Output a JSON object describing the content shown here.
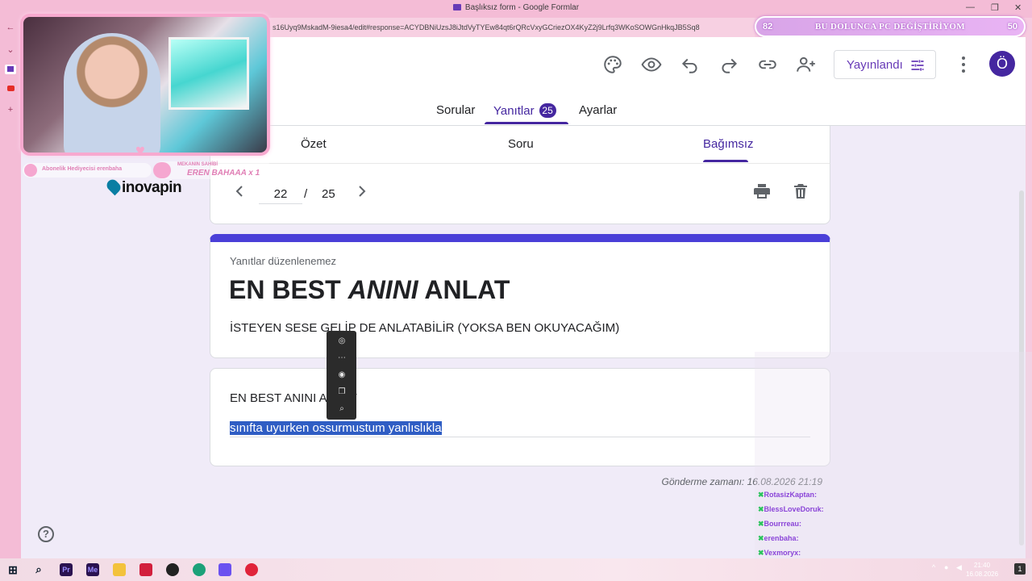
{
  "window": {
    "title": "Başlıksız form - Google Formlar"
  },
  "address": {
    "url": "s16Uyq9MskadM-9iesa4/edit#response=ACYDBNiUzsJ8iJtdVyTYEw84qt6rQRcVxyGCriezOX4KyZ2j9Lrfq3WKoSOWGnHkqJB5Sq8"
  },
  "goal": {
    "left": "82",
    "text": "BU DOLUNCA PC DEĞİŞTİRİYOM",
    "right": "50"
  },
  "header": {
    "publish_label": "Yayınlandı",
    "avatar_letter": "Ö"
  },
  "tabs": [
    {
      "label": "Sorular"
    },
    {
      "label": "Yanıtlar",
      "badge": "25"
    },
    {
      "label": "Ayarlar"
    }
  ],
  "subtabs": [
    {
      "label": "Özet"
    },
    {
      "label": "Soru"
    },
    {
      "label": "Bağımsız"
    }
  ],
  "nav": {
    "current": "22",
    "separator": "/",
    "total": "25"
  },
  "form": {
    "note": "Yanıtlar düzenlenemez",
    "title_part1": "EN BEST ",
    "title_part2": "ANINI",
    "title_part3": " ANLAT",
    "description": "İSTEYEN SESE GELİP DE ANLATABİLİR (YOKSA BEN OKUYACAĞIM)"
  },
  "question": {
    "title": "EN BEST ANINI ANLAT",
    "answer": "sınıfta uyurken ossurmustum yanlıslıkla"
  },
  "submitted": "Gönderme zamanı: 16.08.2026 21:19",
  "overlay": {
    "alert1": "Abonelik Hediyecisi erenbaha",
    "alert2_line1": "MEKANIN SAHİBİ",
    "alert2_line2": "EREN BAHAAA x 1",
    "sponsor": "inovapin"
  },
  "chat": [
    {
      "name": "RotasizKaptan:",
      "msg": ""
    },
    {
      "name": "BlessLoveDoruk:",
      "msg": ""
    },
    {
      "name": "Bourrreau:",
      "msg": ""
    },
    {
      "name": "erenbaha:",
      "msg": ""
    },
    {
      "name": "Vexmoryx:",
      "msg": ""
    }
  ],
  "taskbar": {
    "time": "21:40",
    "date": "16.08.2026",
    "notifications": "1"
  },
  "colors": {
    "accent": "#4527a0",
    "form_bar": "#4a3fd8",
    "background": "#f0ebf8",
    "selection": "#2f5dc4"
  }
}
